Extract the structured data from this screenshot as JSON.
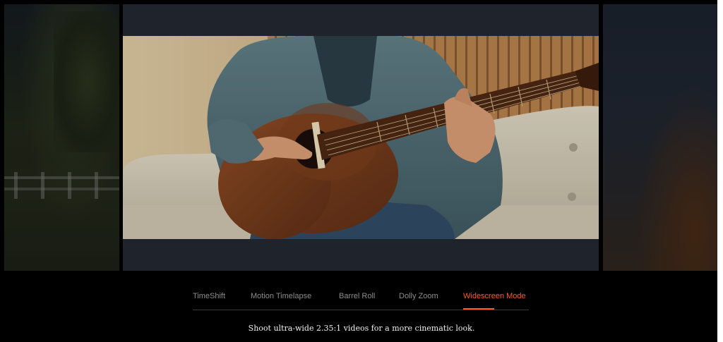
{
  "tabs": [
    {
      "label": "TimeShift",
      "active": false
    },
    {
      "label": "Motion Timelapse",
      "active": false
    },
    {
      "label": "Barrel Roll",
      "active": false
    },
    {
      "label": "Dolly Zoom",
      "active": false
    },
    {
      "label": "Widescreen Mode",
      "active": true
    }
  ],
  "caption": "Shoot ultra-wide 2.35:1 videos for a more cinematic look.",
  "colors": {
    "accent": "#ff5a1f",
    "tab_inactive": "#8c8c8c",
    "background": "#000000",
    "letterbox": "#1f232b"
  }
}
